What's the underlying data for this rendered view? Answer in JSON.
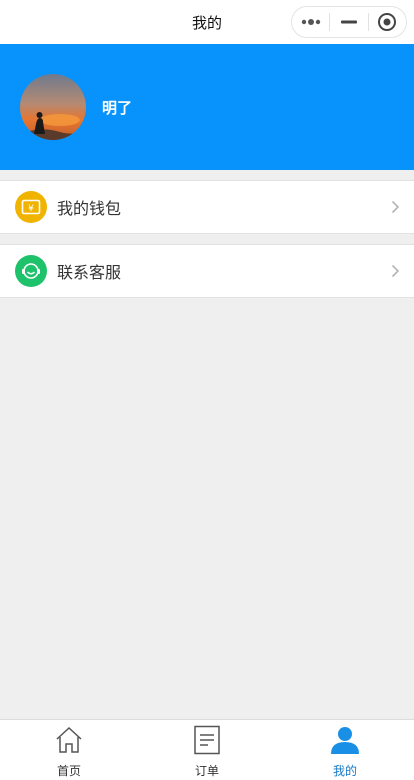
{
  "navbar": {
    "title": "我的"
  },
  "capsule": {
    "menu_icon": "more-dots-icon",
    "minimize_icon": "minimize-icon",
    "close_icon": "target-circle-icon"
  },
  "profile": {
    "username": "明了",
    "avatar_icon": "user-avatar-photo"
  },
  "menu": [
    {
      "label": "我的钱包",
      "icon": "wallet-icon",
      "icon_color": "#f0b400"
    },
    {
      "label": "联系客服",
      "icon": "customer-service-icon",
      "icon_color": "#1ec26b"
    }
  ],
  "tabbar": {
    "tabs": [
      {
        "label": "首页",
        "icon": "home-icon",
        "active": false
      },
      {
        "label": "订单",
        "icon": "order-icon",
        "active": false
      },
      {
        "label": "我的",
        "icon": "user-icon",
        "active": true
      }
    ]
  },
  "colors": {
    "header_bg": "#0793fb",
    "active_tab": "#1479c6",
    "page_bg": "#efefef"
  }
}
